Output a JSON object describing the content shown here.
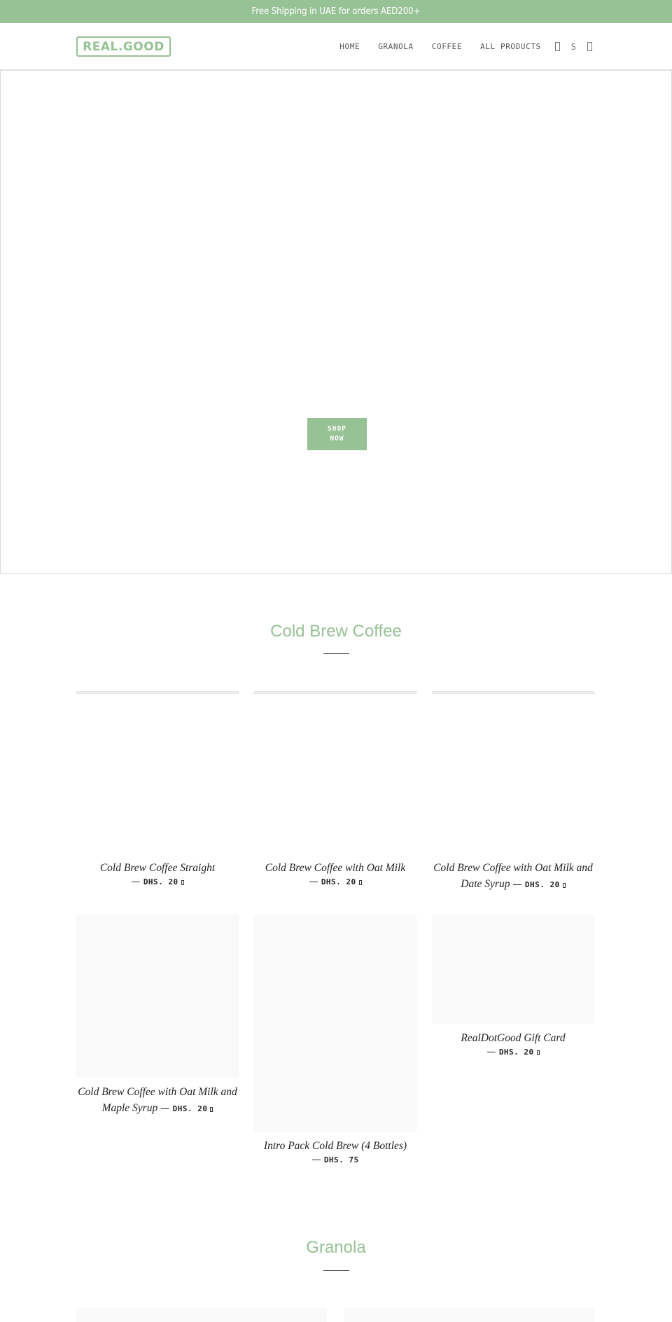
{
  "announcement": "Free Shipping in UAE for orders AED200+",
  "header": {
    "logo": "REAL.GOOD",
    "nav": [
      {
        "label": "HOME"
      },
      {
        "label": "GRANOLA"
      },
      {
        "label": "COFFEE"
      },
      {
        "label": "ALL PRODUCTS"
      }
    ],
    "icons": {
      "search": "search-icon",
      "account_label": "S",
      "cart": "cart-icon"
    }
  },
  "hero": {
    "button_line1": "SHOP",
    "button_line2": "NOW"
  },
  "colors": {
    "accent": "#97c295",
    "placeholder": "#f9f9f9",
    "divider": "#555555"
  },
  "sections": [
    {
      "title": "Cold Brew Coffee",
      "products": [
        {
          "name": "Cold Brew Coffee Straight",
          "price": "DHS. 20",
          "has_icon": true
        },
        {
          "name": "Cold Brew Coffee with Oat Milk",
          "price": "DHS. 20",
          "has_icon": true
        },
        {
          "name": "Cold Brew Coffee with Oat Milk and Date Syrup",
          "price": "DHS. 20",
          "has_icon": true
        },
        {
          "name": "Cold Brew Coffee with Oat Milk and Maple Syrup",
          "price": "DHS. 20",
          "has_icon": true
        },
        {
          "name": "Intro Pack Cold Brew (4 Bottles)",
          "price": "DHS. 75",
          "has_icon": false
        },
        {
          "name": "RealDotGood Gift Card",
          "price": "DHS. 20",
          "has_icon": true
        }
      ]
    },
    {
      "title": "Granola"
    }
  ],
  "price_dash": "—"
}
